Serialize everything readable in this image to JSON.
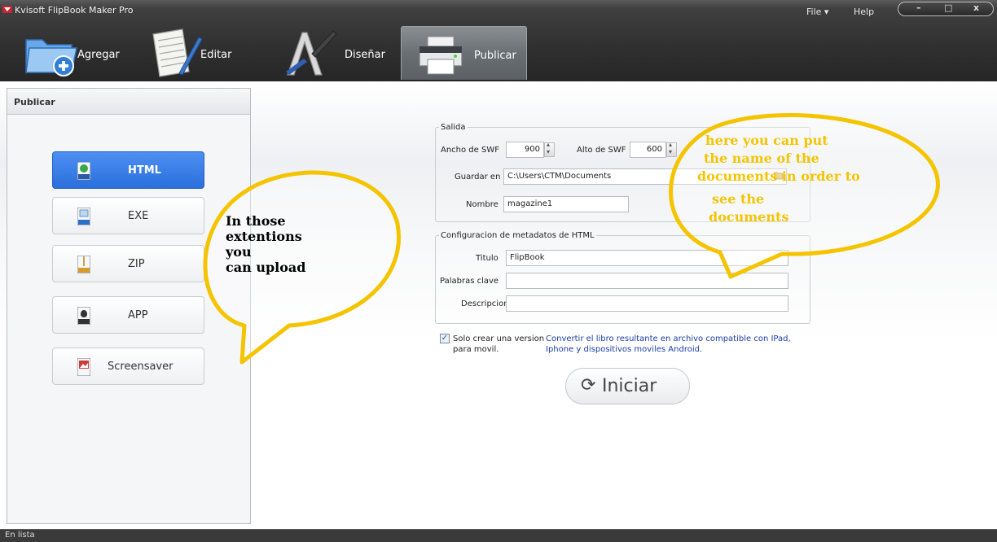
{
  "app": {
    "title": "Kvisoft FlipBook Maker Pro",
    "menu": {
      "file": "File ▾",
      "help": "Help"
    },
    "window_controls": {
      "minimize": "–",
      "maximize": "□",
      "close": "x"
    }
  },
  "toolbar": {
    "tabs": [
      {
        "label": "Agregar",
        "icon": "folder-add-icon"
      },
      {
        "label": "Editar",
        "icon": "document-edit-icon"
      },
      {
        "label": "Diseñar",
        "icon": "brush-design-icon"
      },
      {
        "label": "Publicar",
        "icon": "printer-icon",
        "active": true
      }
    ]
  },
  "left_panel": {
    "title": "Publicar",
    "formats": [
      {
        "label": "HTML",
        "icon": "html-file-icon",
        "active": true
      },
      {
        "label": "EXE",
        "icon": "exe-file-icon"
      },
      {
        "label": "ZIP",
        "icon": "zip-file-icon"
      },
      {
        "label": "APP",
        "icon": "mac-app-icon"
      },
      {
        "label": "Screensaver",
        "icon": "screensaver-icon"
      }
    ]
  },
  "output": {
    "legend": "Salida",
    "width_label": "Ancho de SWF",
    "width_value": "900",
    "height_label": "Alto de SWF",
    "height_value": "600",
    "save_label": "Guardar en",
    "save_value": "C:\\Users\\CTM\\Documents",
    "name_label": "Nombre",
    "name_value": "magazine1"
  },
  "metadata": {
    "legend": "Configuracion de metadatos de HTML",
    "title_label": "Titulo",
    "title_value": "FlipBook",
    "keywords_label": "Palabras clave",
    "keywords_value": "",
    "description_label": "Descripcion",
    "description_value": ""
  },
  "mobile": {
    "checked": true,
    "label_line1": "Solo crear una version",
    "label_line2": "para movil.",
    "desc_line1": "Convertir el libro resultante en archivo compatible con IPad,",
    "desc_line2": "Iphone y dispositivos moviles Android."
  },
  "start_button": {
    "label": "Iniciar"
  },
  "status_bar": {
    "text": "En lista"
  },
  "annotations": {
    "left_bubble": [
      "In those",
      "extentions",
      "you",
      "can upload"
    ],
    "right_bubble": [
      "here you can put",
      "the name of the",
      "documents in order to",
      "see the",
      "documents"
    ],
    "bubble_color": "#f5c400",
    "right_text_color": "#f5c400"
  }
}
